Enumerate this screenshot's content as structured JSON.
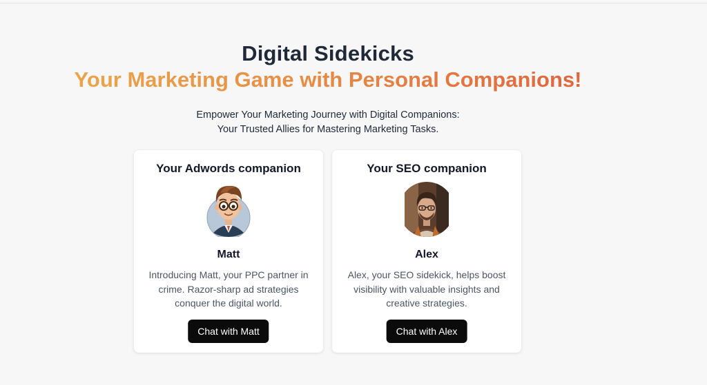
{
  "hero": {
    "title": "Digital Sidekicks",
    "subtitle": "Your Marketing Game with Personal Companions!",
    "intro_line1": "Empower Your Marketing Journey with Digital Companions:",
    "intro_line2": "Your Trusted Allies for Mastering Marketing Tasks."
  },
  "cards": [
    {
      "title": "Your Adwords companion",
      "name": "Matt",
      "description": "Introducing Matt, your PPC partner in crime. Razor-sharp ad strategies conquer the digital world.",
      "button_label": "Chat with Matt",
      "avatar_icon": "cartoon-man-glasses-avatar"
    },
    {
      "title": "Your SEO companion",
      "name": "Alex",
      "description": "Alex, your SEO sidekick, helps boost visibility with valuable insights and creative strategies.",
      "button_label": "Chat with Alex",
      "avatar_icon": "man-glasses-photo-avatar"
    }
  ],
  "colors": {
    "background": "#f7f7f7",
    "title": "#1f2937",
    "gradient_start": "#ecad4f",
    "gradient_end": "#dd5c3a",
    "button": "#0b0b0b"
  }
}
